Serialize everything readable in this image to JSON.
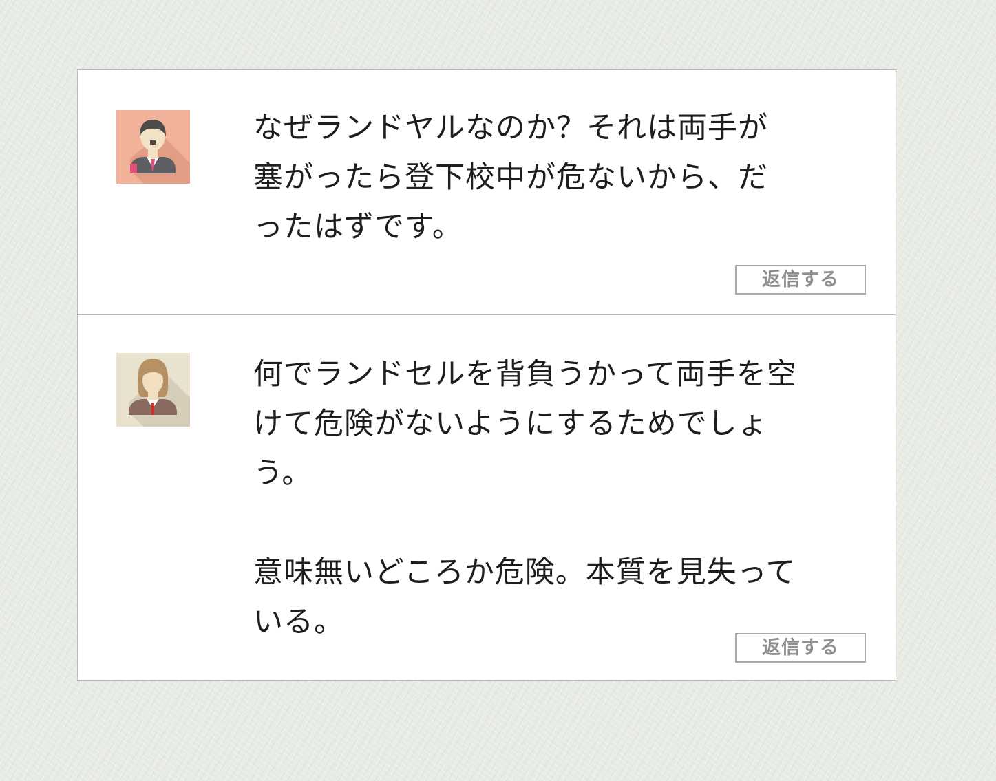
{
  "comments": [
    {
      "avatar_icon": "man-avatar-icon",
      "text": "なぜランドヤルなのか？それは両手が塞がったら登下校中が危ないから、だったはずです。",
      "reply_label": "返信する"
    },
    {
      "avatar_icon": "woman-avatar-icon",
      "text": "何でランドセルを背負うかって両手を空けて危険がないようにするためでしょう。\n\n意味無いどころか危険。本質を見失っている。",
      "reply_label": "返信する"
    }
  ],
  "colors": {
    "page_background": "#e7ebe4",
    "card_background": "#ffffff",
    "border": "#b9b9b9",
    "text": "#1e1e1e",
    "reply_text": "#8f8f8f",
    "avatar_man_background": "#f2b29a",
    "avatar_woman_background": "#e8e2cf"
  }
}
